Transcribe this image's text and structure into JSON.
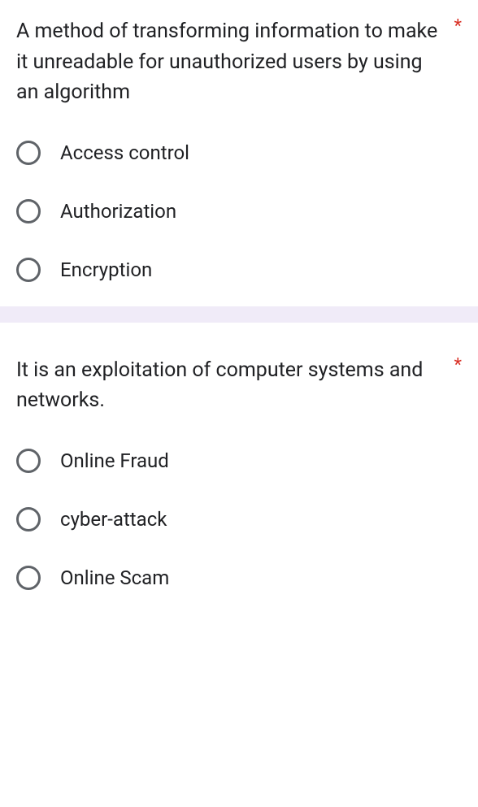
{
  "questions": [
    {
      "text": "A method of transforming information to make it unreadable for unauthorized users by using an algorithm",
      "required": "*",
      "options": [
        {
          "label": "Access control"
        },
        {
          "label": "Authorization"
        },
        {
          "label": "Encryption"
        }
      ]
    },
    {
      "text": "It is an exploitation of computer systems and networks.",
      "required": "*",
      "options": [
        {
          "label": "Online Fraud"
        },
        {
          "label": "cyber-attack"
        },
        {
          "label": "Online Scam"
        }
      ]
    }
  ]
}
